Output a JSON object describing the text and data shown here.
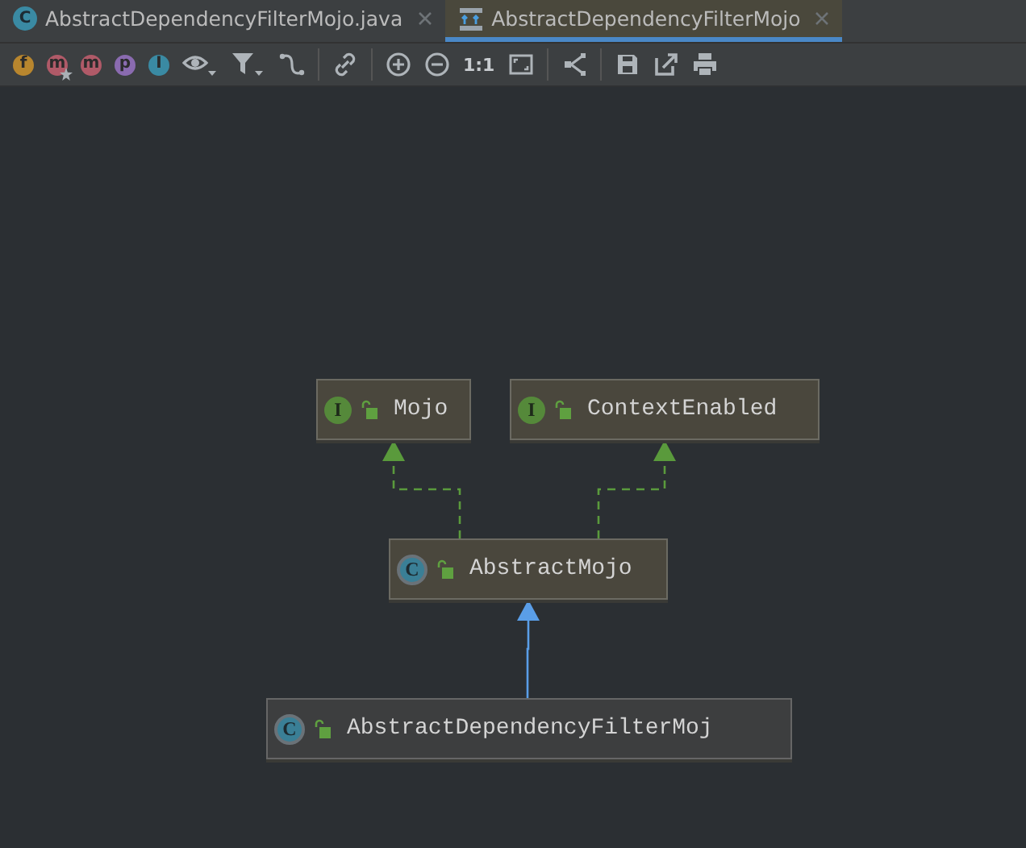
{
  "tabs": [
    {
      "label": "AbstractDependencyFilterMojo.java",
      "kind": "class",
      "badge": "C",
      "selected": false
    },
    {
      "label": "AbstractDependencyFilterMojo",
      "kind": "diagram",
      "selected": true
    }
  ],
  "toolbar": {
    "filters": [
      {
        "letter": "f",
        "color": "#b8862e",
        "starred": false
      },
      {
        "letter": "m",
        "color": "#b05a68",
        "starred": true
      },
      {
        "letter": "m",
        "color": "#b05a68",
        "starred": false
      },
      {
        "letter": "p",
        "color": "#8a6bb0",
        "starred": false
      },
      {
        "letter": "I",
        "color": "#3a8aa3",
        "starred": false
      }
    ],
    "zoom_actual": "1:1"
  },
  "diagram": {
    "nodes": [
      {
        "name": "Mojo",
        "kind": "interface",
        "badge": "I",
        "selected": false
      },
      {
        "name": "ContextEnabled",
        "kind": "interface",
        "badge": "I",
        "selected": false
      },
      {
        "name": "AbstractMojo",
        "kind": "class",
        "badge": "C",
        "selected": false
      },
      {
        "name": "AbstractDependencyFilterMoj",
        "kind": "class",
        "badge": "C",
        "selected": true
      }
    ],
    "edges": [
      {
        "kind": "implements"
      },
      {
        "kind": "implements"
      },
      {
        "kind": "extends"
      }
    ]
  }
}
